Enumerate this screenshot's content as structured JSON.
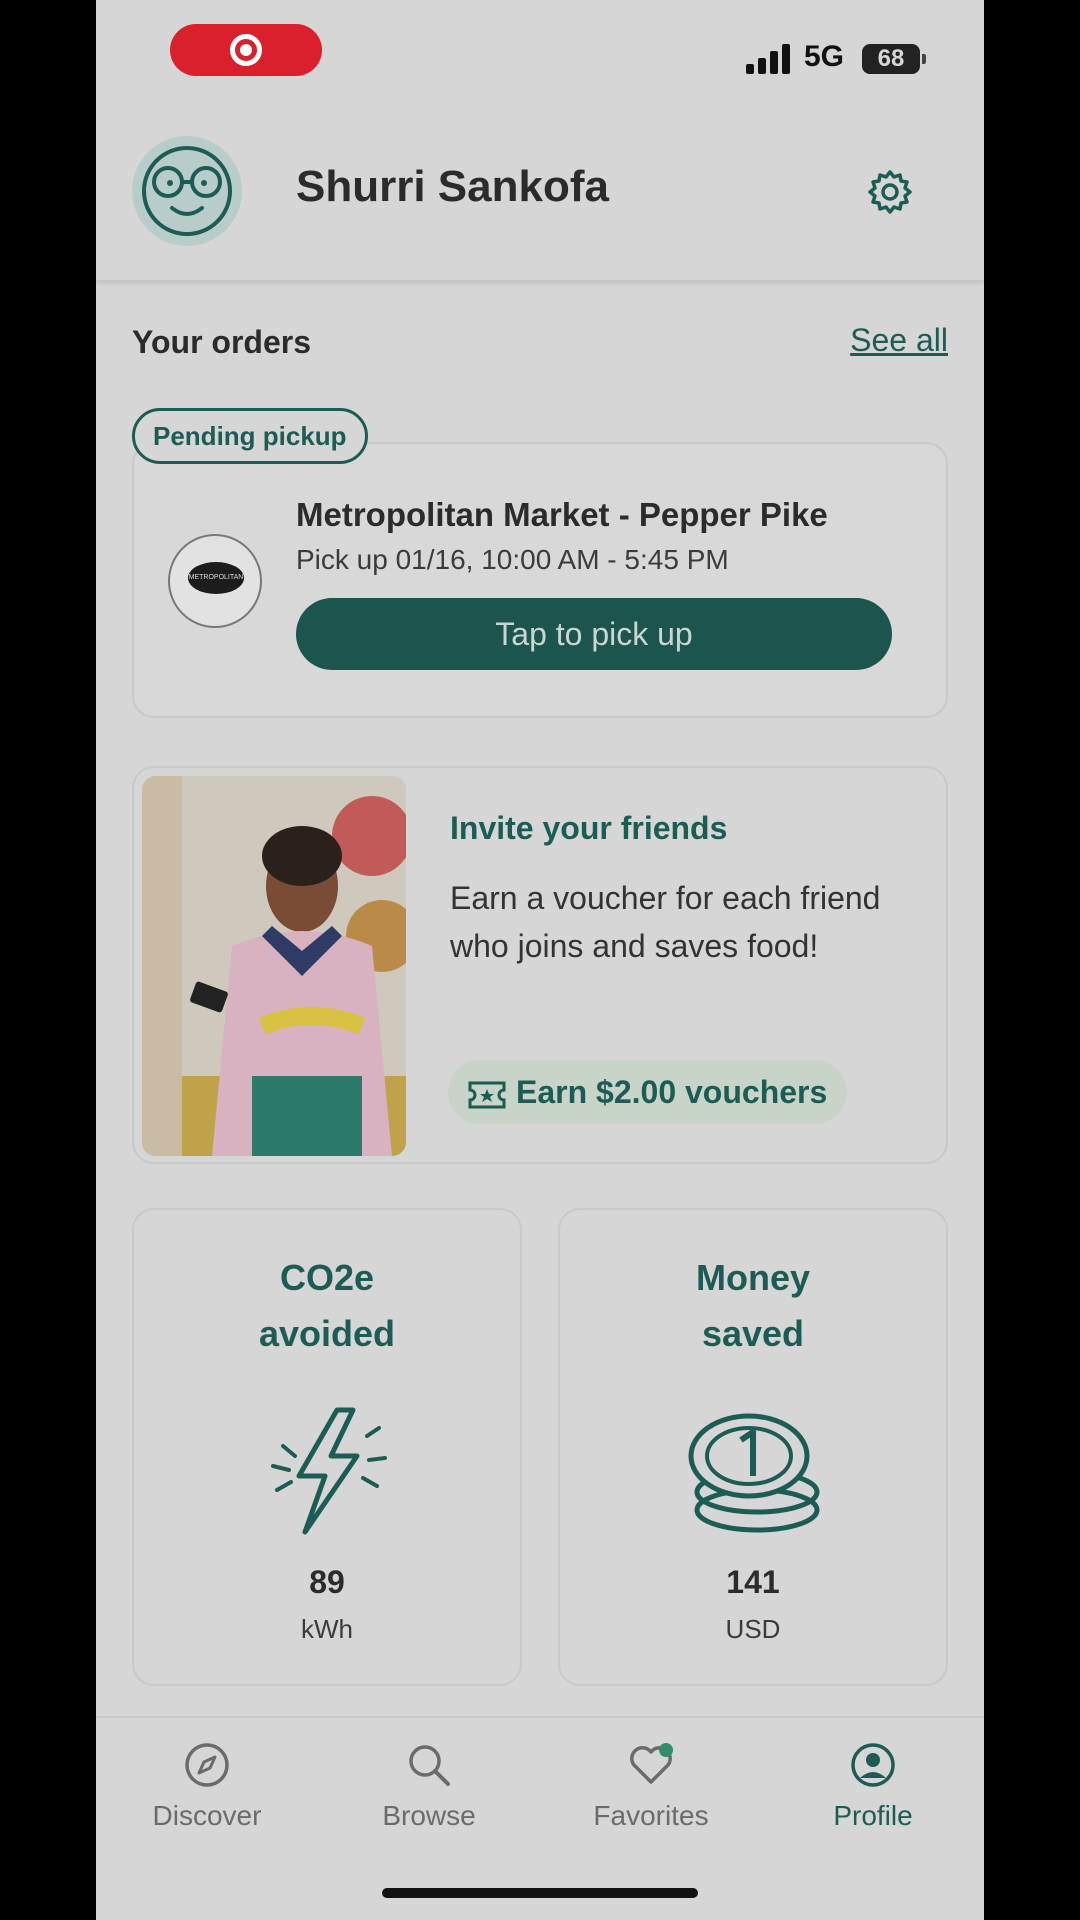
{
  "status_bar": {
    "network": "5G",
    "battery": "68"
  },
  "header": {
    "username": "Shurri Sankofa"
  },
  "orders": {
    "title": "Your orders",
    "see_all": "See all",
    "badge": "Pending pickup",
    "store_name": "Metropolitan Market  - Pepper Pike",
    "pickup_time": "Pick up 01/16, 10:00 AM - 5:45 PM",
    "button": "Tap to pick up"
  },
  "invite": {
    "title": "Invite your friends",
    "text": "Earn a voucher for each friend who joins and saves food!",
    "voucher": "Earn $2.00 vouchers"
  },
  "stats": {
    "co2": {
      "title_line1": "CO2e",
      "title_line2": "avoided",
      "value": "89",
      "unit": "kWh"
    },
    "money": {
      "title_line1": "Money",
      "title_line2": "saved",
      "value": "141",
      "unit": "USD"
    }
  },
  "tabs": [
    {
      "label": "Discover",
      "icon": "compass-icon"
    },
    {
      "label": "Browse",
      "icon": "search-icon"
    },
    {
      "label": "Favorites",
      "icon": "heart-icon"
    },
    {
      "label": "Profile",
      "icon": "user-icon"
    }
  ],
  "colors": {
    "brand": "#1d5c54",
    "record": "#d9202c"
  }
}
